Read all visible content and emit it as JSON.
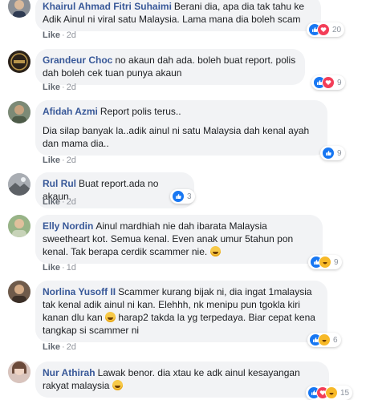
{
  "like_label": "Like",
  "dot": "·",
  "comments": [
    {
      "name": "Khairul Ahmad Fitri Suhaimi",
      "paragraphs": [
        "Berani dia, apa dia tak tahu ke Adik Ainul ni viral satu Malaysia. Lama mana dia boleh scam"
      ],
      "time": "2d",
      "reactions": [
        "like",
        "love"
      ],
      "count": "20"
    },
    {
      "name": "Grandeur Choc",
      "paragraphs": [
        "no akaun dah ada. boleh buat report. polis dah boleh cek tuan punya akaun"
      ],
      "time": "2d",
      "reactions": [
        "like",
        "love"
      ],
      "count": "9"
    },
    {
      "name": "Afidah Azmi",
      "paragraphs": [
        "Report polis terus..",
        "Dia silap banyak la..adik ainul ni satu Malaysia dah kenal ayah dan mama dia.."
      ],
      "time": "2d",
      "reactions": [
        "like"
      ],
      "count": "9"
    },
    {
      "name": "Rul Rul",
      "paragraphs": [
        "Buat report.ada no akaun."
      ],
      "time": "2d",
      "reactions": [
        "like"
      ],
      "count": "3"
    },
    {
      "name": "Elly Nordin",
      "paragraphs": [
        "Ainul mardhiah nie dah ibarata Malaysia sweetheart kot. Semua kenal. Even anak umur 5tahun pon kenal. Tak berapa cerdik scammer nie."
      ],
      "time": "1d",
      "reactions": [
        "like",
        "haha"
      ],
      "count": "9",
      "emoji": "grinning-squinting-emoji"
    },
    {
      "name": "Norlina Yusoff II",
      "paragraphs": [
        "Scammer kurang bijak ni, dia ingat 1malaysia tak kenal adik ainul ni kan. Elehhh, nk menipu pun tgokla kiri kanan dlu kan",
        "harap2 takda la yg terpedaya. Biar cepat kena tangkap si scammer ni"
      ],
      "time": "2d",
      "reactions": [
        "like",
        "haha"
      ],
      "count": "6",
      "emoji": "grinning-squinting-emoji"
    },
    {
      "name": "Nur Athirah",
      "paragraphs": [
        "Lawak benor. dia xtau ke adk ainul kesayangan rakyat malaysia"
      ],
      "time": "",
      "reactions": [
        "like",
        "love",
        "haha"
      ],
      "count": "15",
      "emoji": "grinning-squinting-emoji"
    }
  ],
  "colors": {
    "name_link": "#385898",
    "bubble_bg": "#f2f3f5",
    "like_blue": "#1877f2",
    "love_red": "#f33e58",
    "haha_yellow": "#f7b928"
  }
}
